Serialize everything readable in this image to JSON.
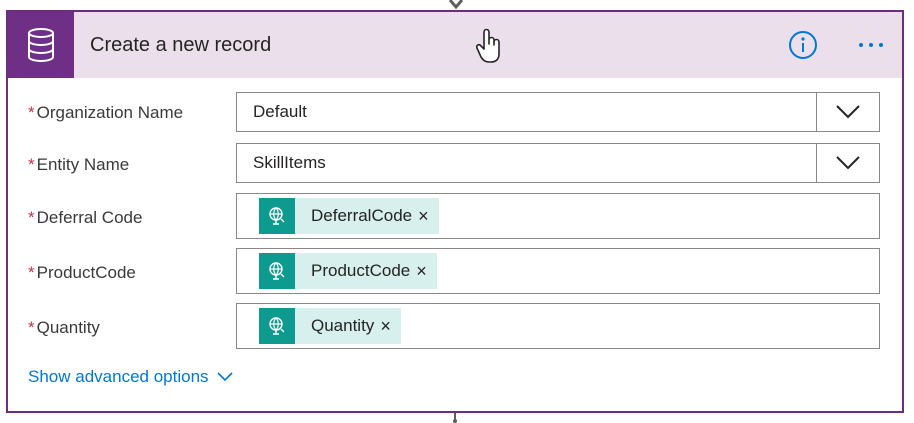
{
  "card": {
    "title": "Create a new record"
  },
  "fields": [
    {
      "required_mark": "*",
      "label": "Organization Name",
      "type": "select",
      "value": "Default"
    },
    {
      "required_mark": "*",
      "label": "Entity Name",
      "type": "select",
      "value": "SkillItems"
    },
    {
      "required_mark": "*",
      "label": "Deferral Code",
      "type": "token",
      "token": "DeferralCode",
      "remove": "×"
    },
    {
      "required_mark": "*",
      "label": "ProductCode",
      "type": "token",
      "token": "ProductCode",
      "remove": "×"
    },
    {
      "required_mark": "*",
      "label": "Quantity",
      "type": "token",
      "token": "Quantity",
      "remove": "×"
    }
  ],
  "advanced": {
    "label": "Show advanced options"
  },
  "icons": {
    "header": "database-icon",
    "info": "info-icon",
    "more": "more-options-icon",
    "token": "dynamic-content-icon",
    "dropdown": "chevron-down-icon"
  },
  "colors": {
    "accent": "#6f2f86",
    "header_bg": "#ecdfec",
    "link": "#0078d4",
    "token_bg": "#d7f0ee",
    "token_icon_bg": "#0e9b8f",
    "required": "#c4314b"
  }
}
